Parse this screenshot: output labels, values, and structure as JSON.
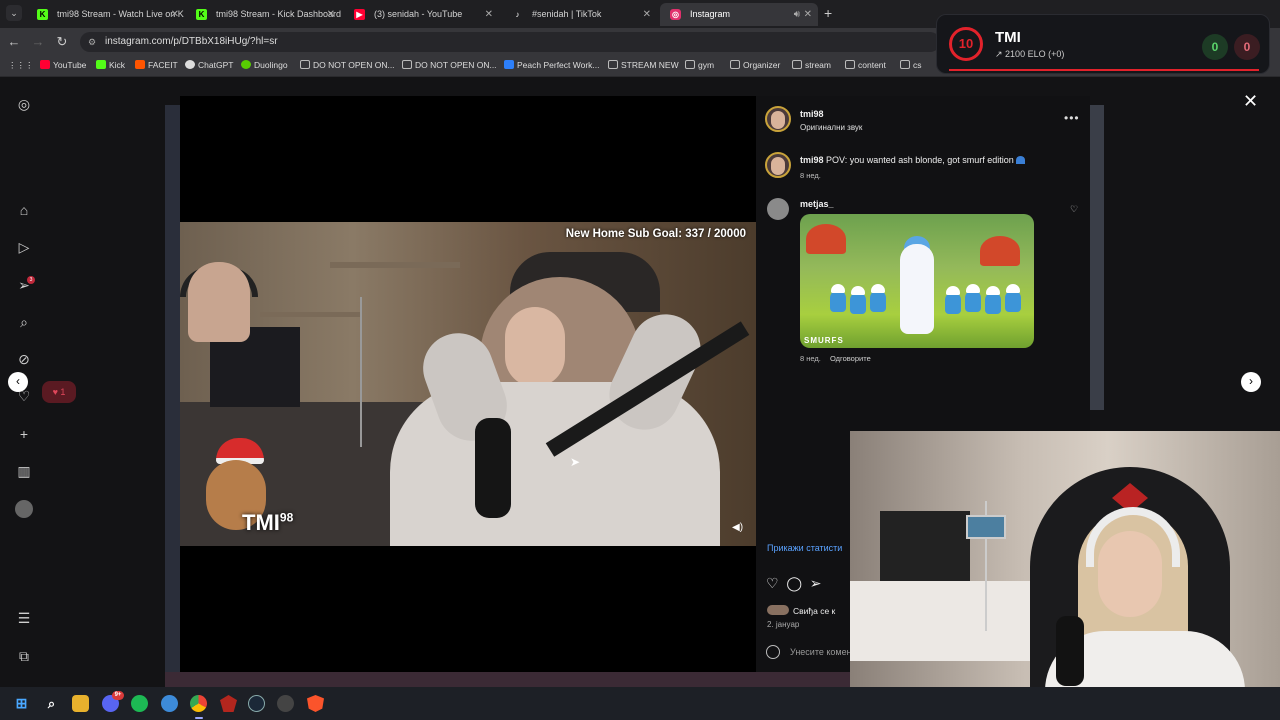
{
  "tabs": [
    {
      "title": "tmi98 Stream - Watch Live on K",
      "icon": "kick-icon",
      "color": "#53fc18",
      "glyph": "K"
    },
    {
      "title": "tmi98 Stream - Kick Dashboard",
      "icon": "kick-icon",
      "color": "#53fc18",
      "glyph": "K"
    },
    {
      "title": "(3) senidah - YouTube",
      "icon": "youtube-icon",
      "color": "#ff0033",
      "glyph": "▶"
    },
    {
      "title": "#senidah | TikTok",
      "icon": "tiktok-icon",
      "color": "#ffffff",
      "glyph": "♪"
    },
    {
      "title": "Instagram",
      "icon": "instagram-icon",
      "color": "#e1306c",
      "glyph": "◎"
    }
  ],
  "url": "instagram.com/p/DTBbX18iHUg/?hl=sr",
  "bookmarks": [
    {
      "label": "YouTube",
      "type": "site",
      "color": "#ff0033"
    },
    {
      "label": "Kick",
      "type": "site",
      "color": "#53fc18"
    },
    {
      "label": "FACEIT",
      "type": "site",
      "color": "#ff5500"
    },
    {
      "label": "ChatGPT",
      "type": "site",
      "color": "#dddddd"
    },
    {
      "label": "Duolingo",
      "type": "site",
      "color": "#58cc02"
    },
    {
      "label": "DO NOT OPEN ON...",
      "type": "folder"
    },
    {
      "label": "DO NOT OPEN ON...",
      "type": "folder"
    },
    {
      "label": "Peach Perfect Work...",
      "type": "site",
      "color": "#2d7ff9"
    },
    {
      "label": "STREAM NEW",
      "type": "folder"
    },
    {
      "label": "gym",
      "type": "folder"
    },
    {
      "label": "Organizer",
      "type": "folder"
    },
    {
      "label": "stream",
      "type": "folder"
    },
    {
      "label": "content",
      "type": "folder"
    },
    {
      "label": "cs",
      "type": "folder"
    }
  ],
  "sidebar": {
    "notification_count": "3",
    "like_badge": "1"
  },
  "video": {
    "sub_goal": "New Home Sub Goal:  337 / 20000",
    "logo": "TMI",
    "logo_sup": "98"
  },
  "post": {
    "author": "tmi98",
    "audio": "Оригинални звук",
    "caption_user": "tmi98",
    "caption_text": " POV: you wanted ash blonde, got smurf edition",
    "caption_age": "8 нед.",
    "comment_user": "metjas_",
    "comment_gif_label": "SMURFS",
    "comment_age": "8 нед.",
    "comment_reply": "Одговорите",
    "view_stats": "Прикажи статисти",
    "likes": "Свиђа се к",
    "date": "2. јануар",
    "comment_placeholder": "Унесите комен"
  },
  "overlay": {
    "level": "10",
    "name": "TMI",
    "elo": "2100 ELO (+0)",
    "wins": "0",
    "losses": "0",
    "accent": "#e2222b"
  },
  "taskbar": {
    "discord_badge": "9+"
  }
}
